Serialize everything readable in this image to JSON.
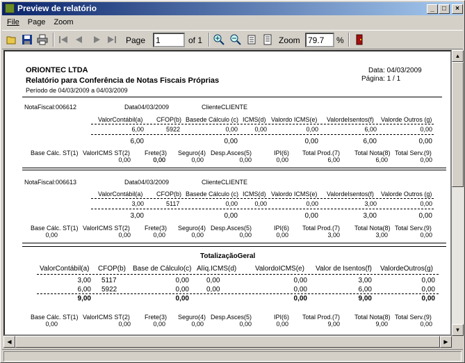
{
  "window": {
    "title": "Preview de relatório"
  },
  "menu": [
    "File",
    "Page",
    "Zoom"
  ],
  "toolbar": {
    "page_label": "Page",
    "page_value": "1",
    "of_label": "of 1",
    "zoom_label": "Zoom",
    "zoom_value": "79.7",
    "pct": "%"
  },
  "report": {
    "company": "ORIONTEC LTDA",
    "title": "Relatório para Conferência de Notas Fiscais Próprias",
    "period": "Período de 04/03/2009 a 04/03/2009",
    "date_label": "Data: 04/03/2009",
    "page_label": "Página: 1 / 1",
    "head": {
      "vc": "ValorContábil(a)",
      "cfop": "CFOP(b)",
      "base": "Basede Cálculo (c)",
      "icms": "ICMS(d)",
      "vicms": "Valordo ICMS(e)",
      "isentos": "ValordeIsentos(f)",
      "outros": "Valorde Outros (g)"
    },
    "foot": {
      "bst": "Base Cálc. ST(1)",
      "vst": "ValorICMS ST(2)",
      "frete": "Frete(3)",
      "seguro": "Seguro(4)",
      "desp": "Desp.Asces(5)",
      "ipi": "IPI(6)",
      "tprod": "Total Prod.(7)",
      "tnota": "Total Nota(8)",
      "tserv": "Total Serv.(9)"
    },
    "notes": [
      {
        "nf": "NotaFiscal:006612",
        "data": "Data04/03/2009",
        "cliente": "ClienteCLIENTE",
        "vc": "6,00",
        "cfop": "5922",
        "base": "0,00",
        "icms": "0,00",
        "vicms": "0,00",
        "isentos": "6,00",
        "outros": "0,00",
        "sub_vc": "6,00",
        "sub_base": "0,00",
        "sub_vicms": "0,00",
        "sub_isentos": "6,00",
        "sub_outros": "0,00",
        "f": [
          "0,00",
          "0,00",
          "0,00",
          "0,00",
          "0,00",
          "0,00",
          "6,00",
          "6,00",
          "0,00"
        ]
      },
      {
        "nf": "NotaFiscal:006613",
        "data": "Data04/03/2009",
        "cliente": "ClienteCLIENTE",
        "vc": "3,00",
        "cfop": "5117",
        "base": "0,00",
        "icms": "0,00",
        "vicms": "0,00",
        "isentos": "3,00",
        "outros": "0,00",
        "sub_vc": "3,00",
        "sub_base": "0,00",
        "sub_vicms": "0,00",
        "sub_isentos": "3,00",
        "sub_outros": "0,00",
        "f": [
          "0,00",
          "0,00",
          "0,00",
          "0,00",
          "0,00",
          "0,00",
          "3,00",
          "3,00",
          "0,00"
        ]
      }
    ],
    "total": {
      "title": "TotalizaçãoGeral",
      "head": {
        "vc": "ValorContábil(a)",
        "cfop": "CFOP(b)",
        "base": "Base de Cálculo(c)",
        "aliq": "Alíq.ICMS(d)",
        "vicms": "ValordoICMS(e)",
        "isentos": "Valor de Isentos(f)",
        "outros": "ValordeOutros(g)"
      },
      "rows": [
        {
          "vc": "3,00",
          "cfop": "5117",
          "base": "0,00",
          "aliq": "0,00",
          "vicms": "0,00",
          "isentos": "3,00",
          "outros": "0,00"
        },
        {
          "vc": "6,00",
          "cfop": "5922",
          "base": "0,00",
          "aliq": "0,00",
          "vicms": "0,00",
          "isentos": "6,00",
          "outros": "0,00"
        }
      ],
      "sum": {
        "vc": "9,00",
        "base": "0,00",
        "vicms": "0,00",
        "isentos": "9,00",
        "outros": "0,00"
      },
      "f": [
        "0,00",
        "0,00",
        "0,00",
        "0,00",
        "0,00",
        "0,00",
        "9,00",
        "9,00",
        "0,00"
      ]
    }
  }
}
